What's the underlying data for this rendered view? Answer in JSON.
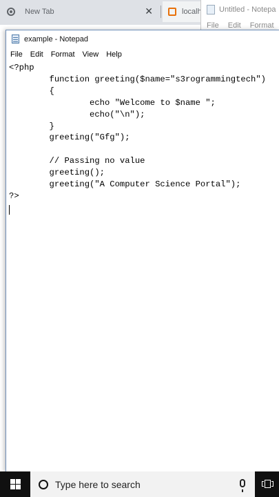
{
  "browser": {
    "tabs": [
      {
        "label": "New Tab",
        "icon": "chrome-icon"
      },
      {
        "label": "localh",
        "icon": "xampp-icon"
      }
    ],
    "close_glyph": "✕"
  },
  "background_notepad": {
    "title": "Untitled - Notepa",
    "menu": [
      "File",
      "Edit",
      "Format"
    ]
  },
  "notepad": {
    "title": "example - Notepad",
    "menu": {
      "file": "File",
      "edit": "Edit",
      "format": "Format",
      "view": "View",
      "help": "Help"
    },
    "content": "<?php\n        function greeting($name=\"s3rogrammingtech\")\n        {\n                echo \"Welcome to $name \";\n                echo(\"\\n\");\n        }\n        greeting(\"Gfg\");\n\n        // Passing no value\n        greeting();\n        greeting(\"A Computer Science Portal\");\n?>"
  },
  "taskbar": {
    "search_placeholder": "Type here to search",
    "icons": [
      "windows-logo-icon",
      "cortana-circle-icon",
      "microphone-icon",
      "task-view-icon"
    ]
  },
  "colors": {
    "tabstrip": "#dee1e6",
    "taskbar": "#101010",
    "search_box": "#f2f2f2",
    "xampp_orange": "#e8710a"
  }
}
